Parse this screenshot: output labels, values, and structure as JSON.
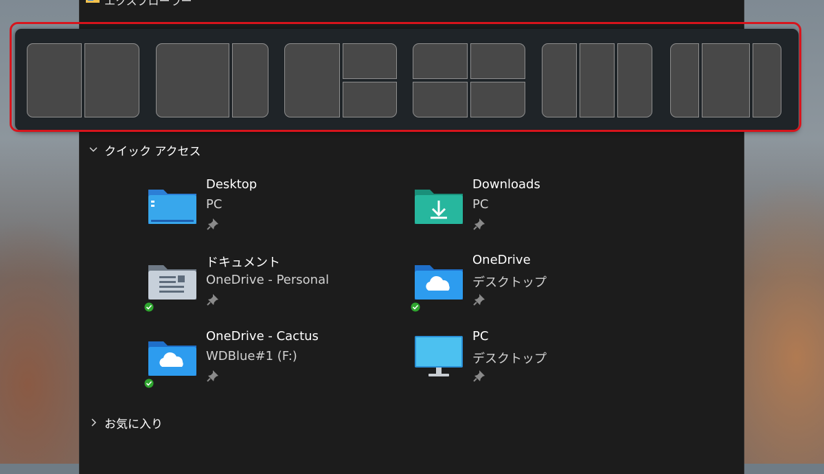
{
  "window": {
    "title": "エクスプローラー"
  },
  "snap_layouts": [
    {
      "id": "halves"
    },
    {
      "id": "two-thirds-one-third"
    },
    {
      "id": "left-half-right-stacked"
    },
    {
      "id": "quarters"
    },
    {
      "id": "three-columns"
    },
    {
      "id": "wide-center-columns"
    }
  ],
  "quick_access": {
    "header": "クイック アクセス",
    "items": [
      {
        "name": "Desktop",
        "sub": "PC",
        "icon": "desktop-folder-icon"
      },
      {
        "name": "Downloads",
        "sub": "PC",
        "icon": "downloads-folder-icon"
      },
      {
        "name": "ドキュメント",
        "sub": "OneDrive - Personal",
        "icon": "documents-folder-icon"
      },
      {
        "name": "OneDrive",
        "sub": "デスクトップ",
        "icon": "onedrive-folder-icon"
      },
      {
        "name": "OneDrive - Cactus",
        "sub": "WDBlue#1 (F:)",
        "icon": "onedrive-folder-icon"
      },
      {
        "name": "PC",
        "sub": "デスクトップ",
        "icon": "monitor-icon"
      }
    ]
  },
  "favorites": {
    "header": "お気に入り"
  },
  "colors": {
    "highlight_outline": "#d8141c",
    "flyout_bg": "#1f2428",
    "zone_fill": "#484848",
    "window_bg": "#1c1c1c"
  }
}
